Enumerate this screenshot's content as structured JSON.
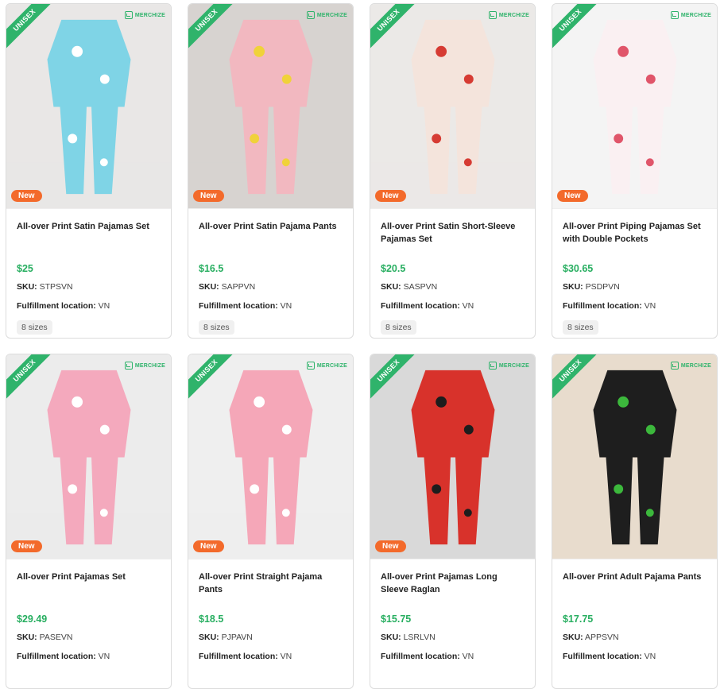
{
  "products": [
    {
      "title": "All-over Print Satin Pajamas Set",
      "price": "$25",
      "sku_label": "SKU:",
      "sku": "STPSVN",
      "loc_label": "Fulfillment location:",
      "location": "VN",
      "sizes": "8 sizes",
      "ribbon": "UNISEX",
      "badge": "New",
      "brand": "MERCHIZE",
      "bg": "#e9e7e6",
      "color1": "#7fd4e6",
      "color2": "#ffffff"
    },
    {
      "title": "All-over Print Satin Pajama Pants",
      "price": "$16.5",
      "sku_label": "SKU:",
      "sku": "SAPPVN",
      "loc_label": "Fulfillment location:",
      "location": "VN",
      "sizes": "8 sizes",
      "ribbon": "UNISEX",
      "badge": "New",
      "brand": "MERCHIZE",
      "bg": "#d7d3d0",
      "color1": "#f2b8c0",
      "color2": "#f0d23a"
    },
    {
      "title": "All-over Print Satin Short-Sleeve Pajamas Set",
      "price": "$20.5",
      "sku_label": "SKU:",
      "sku": "SASPVN",
      "loc_label": "Fulfillment location:",
      "location": "VN",
      "sizes": "8 sizes",
      "ribbon": "UNISEX",
      "badge": "New",
      "brand": "MERCHIZE",
      "bg": "#ebe9e7",
      "color1": "#f4e4dc",
      "color2": "#d63b33"
    },
    {
      "title": "All-over Print Piping Pajamas Set with Double Pockets",
      "price": "$30.65",
      "sku_label": "SKU:",
      "sku": "PSDPVN",
      "loc_label": "Fulfillment location:",
      "location": "VN",
      "sizes": "8 sizes",
      "ribbon": "UNISEX",
      "badge": "New",
      "brand": "MERCHIZE",
      "bg": "#f4f4f4",
      "color1": "#faf0f2",
      "color2": "#e0556a"
    },
    {
      "title": "All-over Print Pajamas Set",
      "price": "$29.49",
      "sku_label": "SKU:",
      "sku": "PASEVN",
      "loc_label": "Fulfillment location:",
      "location": "VN",
      "ribbon": "UNISEX",
      "badge": "New",
      "brand": "MERCHIZE",
      "bg": "#ececec",
      "color1": "#f4a9bd",
      "color2": "#ffffff"
    },
    {
      "title": "All-over Print Straight Pajama Pants",
      "price": "$18.5",
      "sku_label": "SKU:",
      "sku": "PJPAVN",
      "loc_label": "Fulfillment location:",
      "location": "VN",
      "ribbon": "UNISEX",
      "badge": "New",
      "brand": "MERCHIZE",
      "bg": "#efefef",
      "color1": "#f5a7b8",
      "color2": "#ffffff"
    },
    {
      "title": "All-over Print Pajamas Long Sleeve Raglan",
      "price": "$15.75",
      "sku_label": "SKU:",
      "sku": "LSRLVN",
      "loc_label": "Fulfillment location:",
      "location": "VN",
      "ribbon": "UNISEX",
      "badge": "New",
      "brand": "MERCHIZE",
      "bg": "#d9d9d9",
      "color1": "#d8322b",
      "color2": "#1d1d1d"
    },
    {
      "title": "All-over Print Adult Pajama Pants",
      "price": "$17.75",
      "sku_label": "SKU:",
      "sku": "APPSVN",
      "loc_label": "Fulfillment location:",
      "location": "VN",
      "ribbon": "UNISEX",
      "brand": "MERCHIZE",
      "bg": "#e8dccd",
      "color1": "#1e1e1e",
      "color2": "#3cb83c"
    }
  ]
}
